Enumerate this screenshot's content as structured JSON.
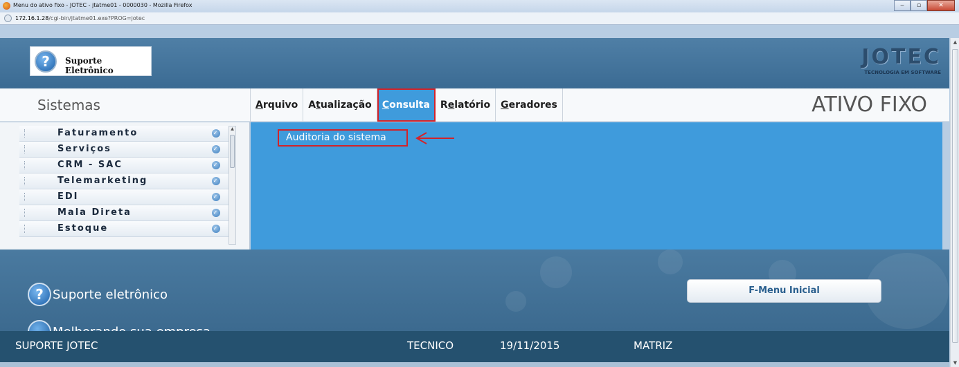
{
  "browser": {
    "window_title": "Menu do ativo fixo - JOTEC - jtatme01 - 0000030 - Mozilla Firefox",
    "url_host": "172.16.1.28",
    "url_path": "/cgi-bin/jtatme01.exe?PROG=jotec"
  },
  "header": {
    "logo_text": "Suporte Eletrônico",
    "brand": "JOTEC",
    "brand_tagline": "TECNOLOGIA EM SOFTWARE"
  },
  "menubar": {
    "sistemas_label": "Sistemas",
    "module_title": "ATIVO FIXO",
    "items": [
      {
        "first": "A",
        "rest": "rquivo"
      },
      {
        "pre": "A",
        "ul": "t",
        "rest": "ualização"
      },
      {
        "first": "C",
        "rest": "onsulta"
      },
      {
        "pre": "R",
        "ul": "e",
        "rest": "latório"
      },
      {
        "first": "G",
        "rest": "eradores"
      }
    ]
  },
  "sidebar": {
    "items": [
      {
        "label": "Faturamento"
      },
      {
        "label": "Serviços"
      },
      {
        "label": "CRM - SAC"
      },
      {
        "label": "Telemarketing"
      },
      {
        "label": "EDI"
      },
      {
        "label": "Mala Direta"
      },
      {
        "label": "Estoque"
      }
    ]
  },
  "content": {
    "submenu_item": "Auditoria do sistema"
  },
  "footer": {
    "line1": "Suporte eletrônico",
    "line2": "Melhorando sua empresa",
    "fmenu_button": "F-Menu Inicial"
  },
  "status": {
    "user": "SUPORTE JOTEC",
    "role": "TECNICO",
    "date": "19/11/2015",
    "branch": "MATRIZ"
  },
  "colors": {
    "accent": "#3f9bdc",
    "highlight_border": "#d2232a",
    "status_bg": "#25516f"
  }
}
